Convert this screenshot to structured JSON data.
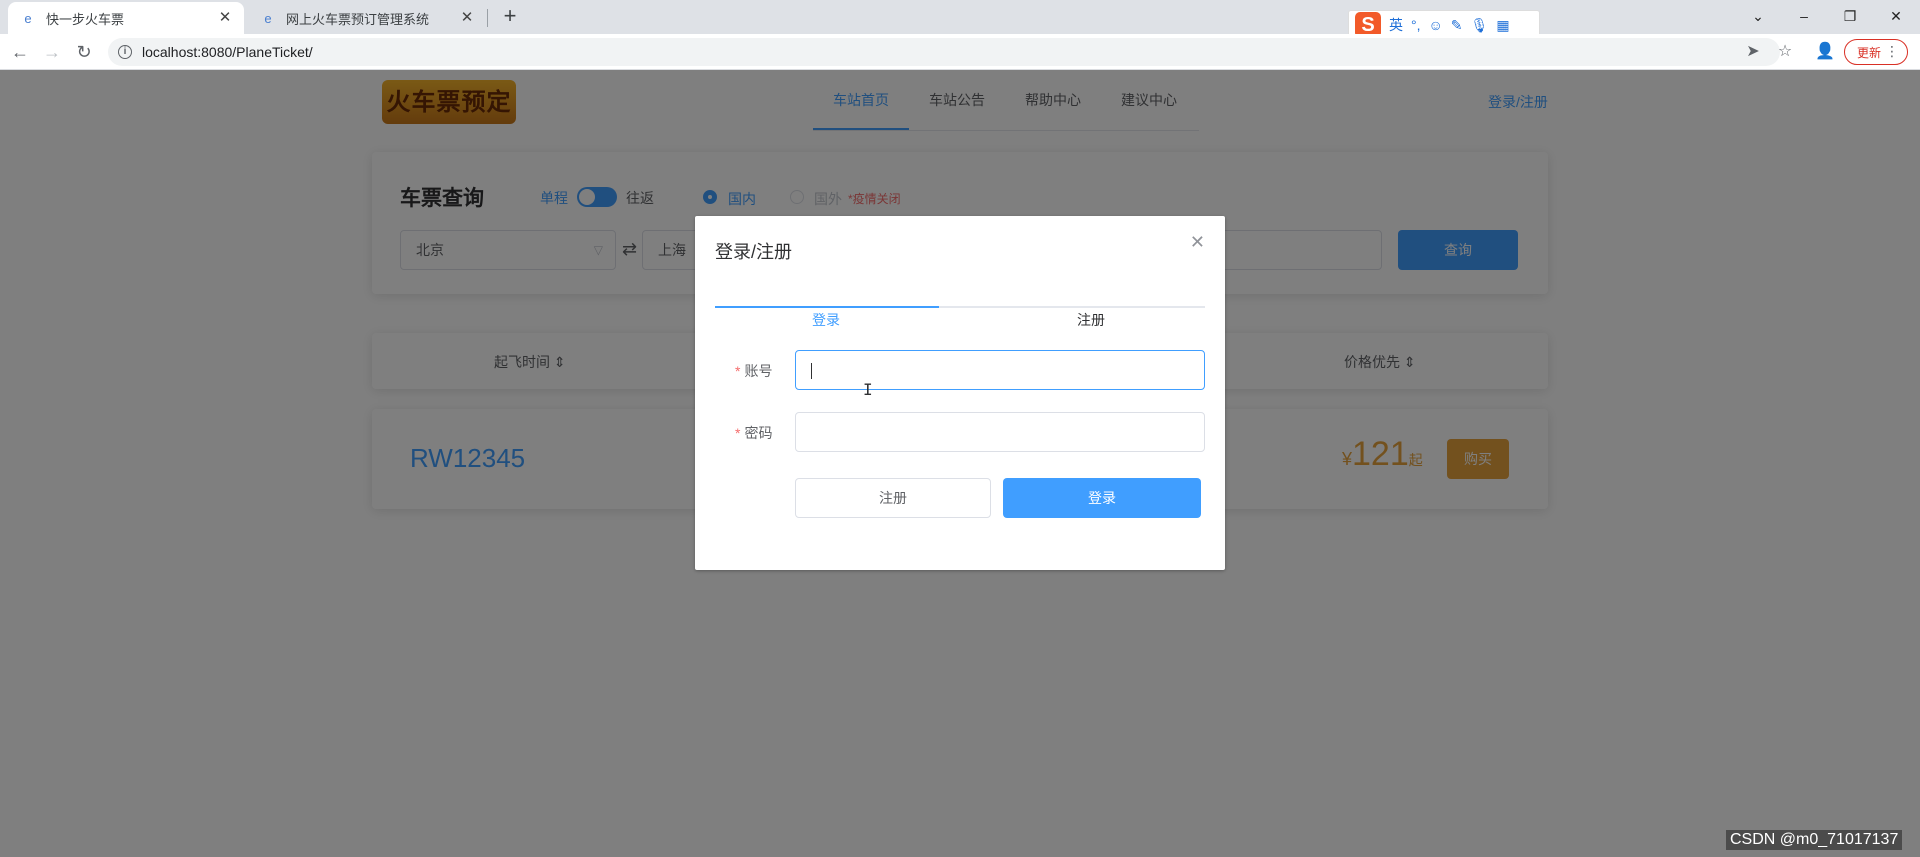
{
  "browser": {
    "tabs": [
      {
        "title": "快一步火车票",
        "close": "✕"
      },
      {
        "title": "网上火车票预订管理系统",
        "close": "✕"
      }
    ],
    "new_tab": "+",
    "window": {
      "minimize": "–",
      "restore": "❐",
      "close": "✕"
    },
    "url": "localhost:8080/PlaneTicket/",
    "update_label": "更新",
    "ime_lang": "英"
  },
  "site": {
    "logo_text": "火车票预定",
    "nav": [
      "车站首页",
      "车站公告",
      "帮助中心",
      "建议中心"
    ],
    "login_link": "登录/注册"
  },
  "search": {
    "title": "车票查询",
    "one_way": "单程",
    "round_trip": "往返",
    "domestic": "国内",
    "foreign": "国外",
    "foreign_note": "*疫情关闭",
    "from": "北京",
    "to": "上海",
    "swap": "⇄",
    "query_button": "查询"
  },
  "sort": {
    "depart_time": "起飞时间 ⇕",
    "price_first": "价格优先 ⇕"
  },
  "result": {
    "train_no": "RW12345",
    "currency": "¥",
    "price": "121",
    "price_suffix": "起",
    "buy_button": "购买"
  },
  "dialog": {
    "title": "登录/注册",
    "close": "✕",
    "tab_login": "登录",
    "tab_register": "注册",
    "account_label": "账号",
    "password_label": "密码",
    "account_value": "",
    "password_value": "",
    "register_button": "注册",
    "login_button": "登录"
  },
  "watermark": "CSDN @m0_71017137",
  "colors": {
    "primary": "#409eff",
    "warning": "#e6a23c",
    "danger": "#f56c6c",
    "overlay": "rgba(0,0,0,0.5)"
  }
}
